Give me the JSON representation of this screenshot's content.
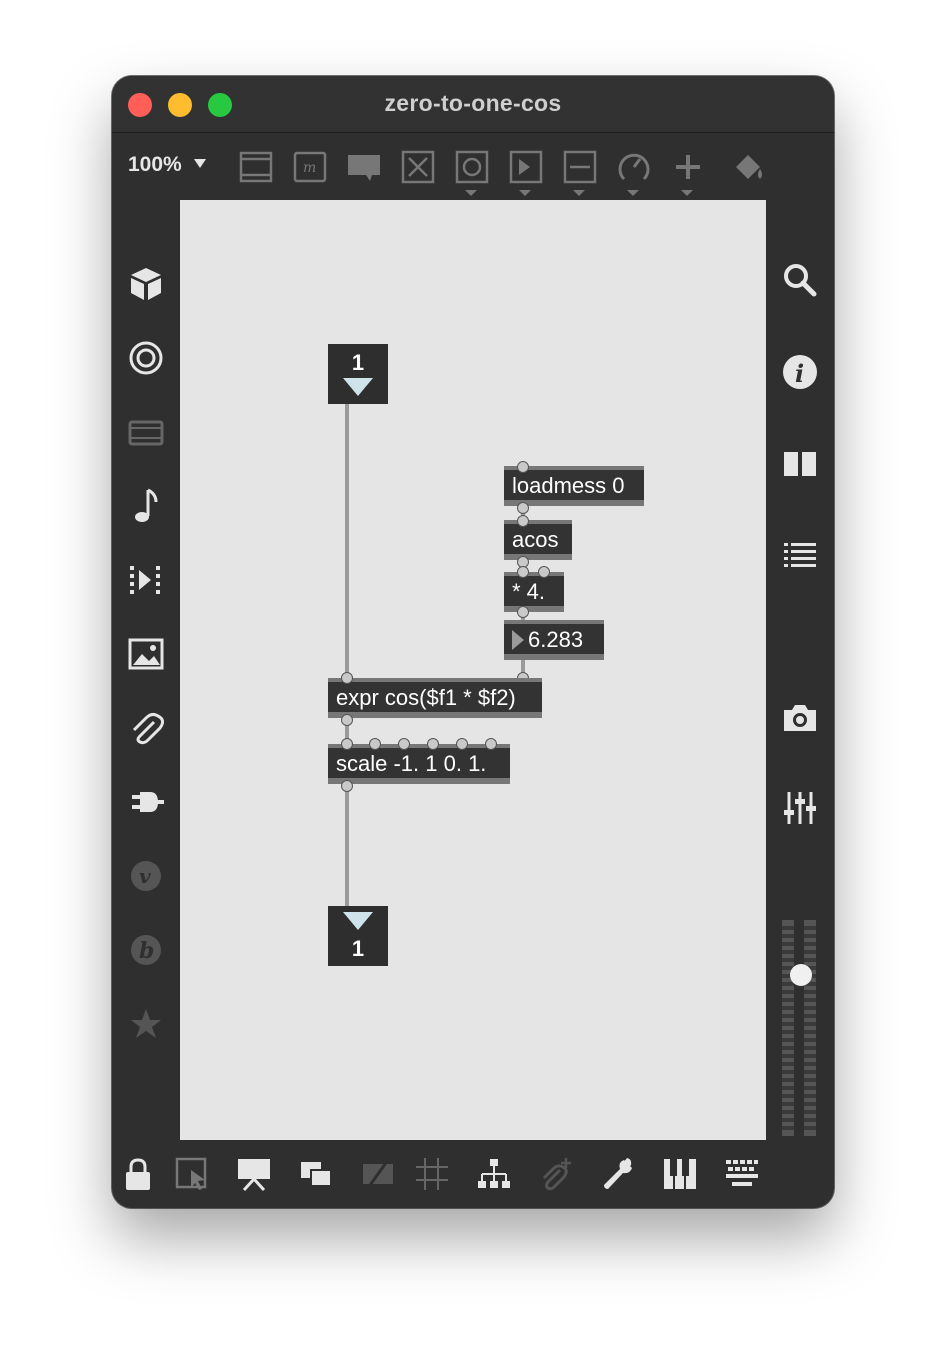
{
  "window": {
    "title": "zero-to-one-cos"
  },
  "toolbar": {
    "zoom": "100%"
  },
  "patch": {
    "inlet_number": "1",
    "outlet_number": "1",
    "loadmess": "loadmess 0",
    "acos": "acos",
    "multiply": "* 4.",
    "number_value": "6.283",
    "expr": "expr cos($f1 * $f2)",
    "scale": "scale -1. 1 0. 1."
  }
}
